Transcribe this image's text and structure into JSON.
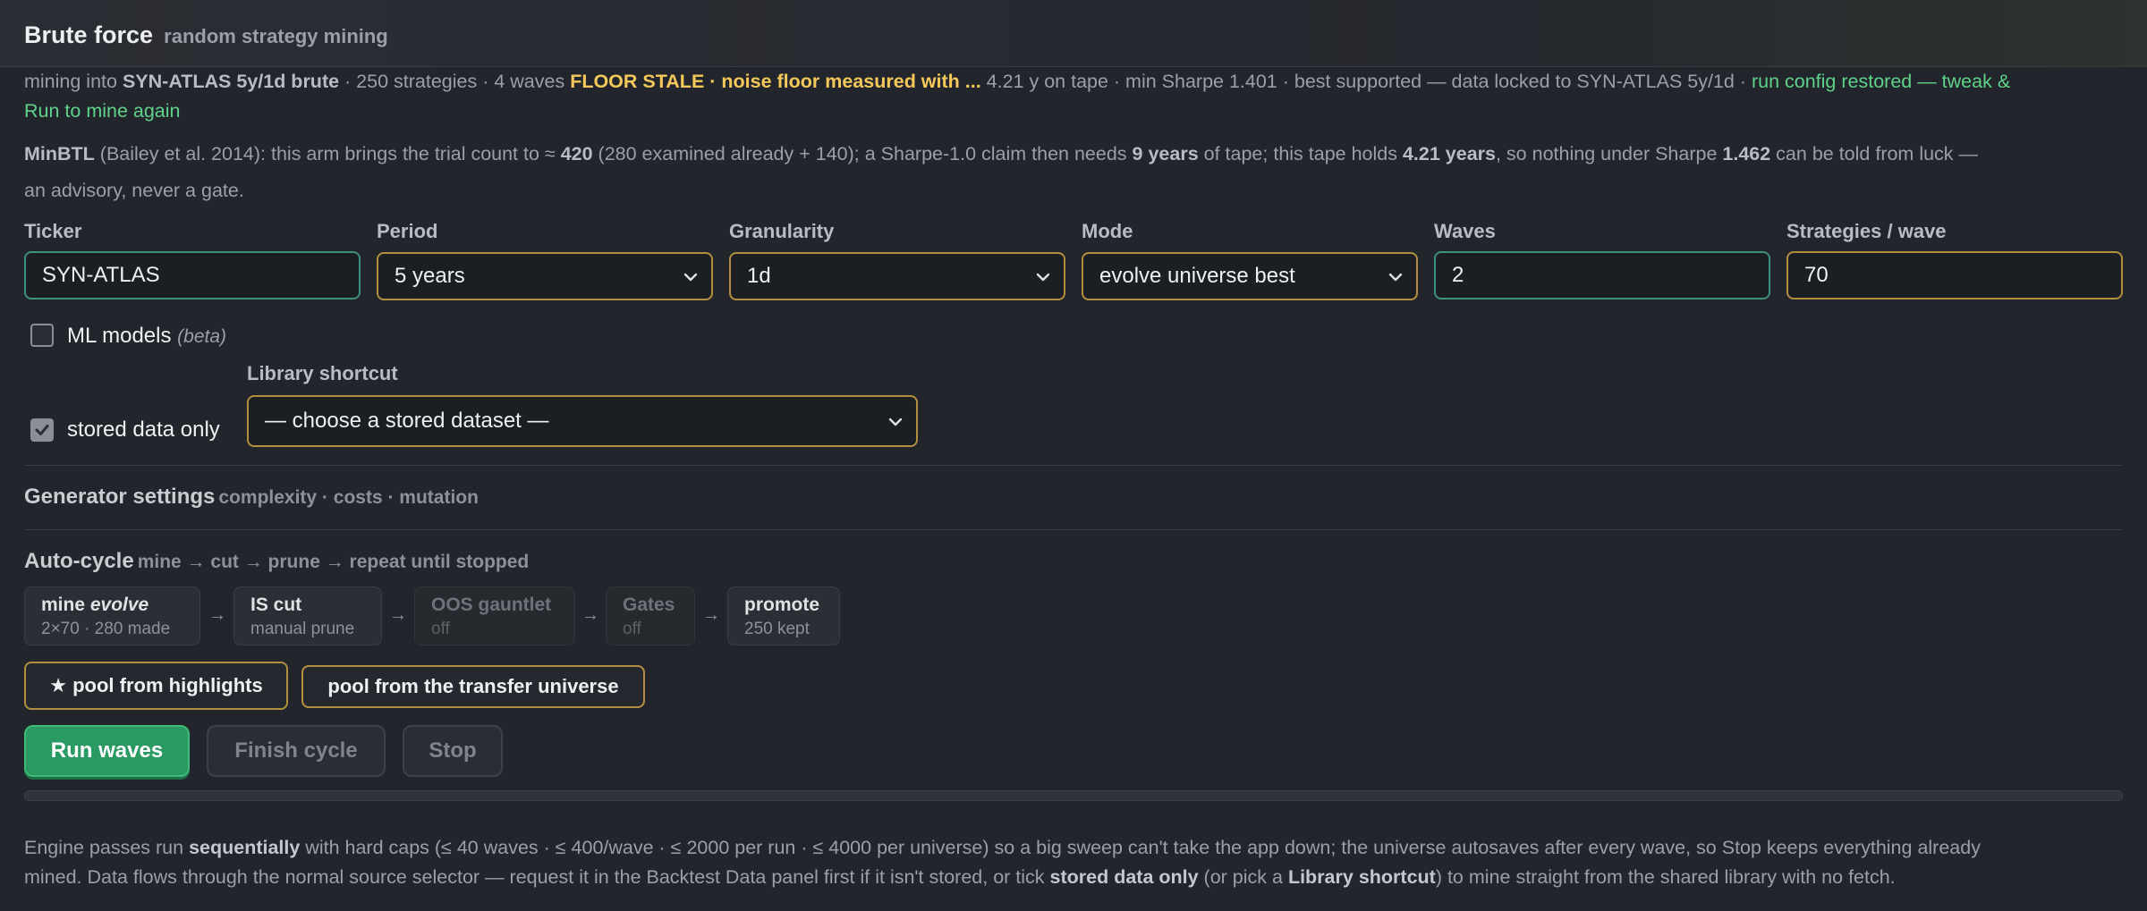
{
  "header": {
    "title": "Brute force",
    "subtitle": "random strategy mining"
  },
  "status": {
    "prefix": "mining into ",
    "target": "SYN-ATLAS 5y/1d brute",
    "mid": " · 250 strategies · 4 waves ",
    "warning": "FLOOR STALE · noise floor measured with ...",
    "tail": " 4.21 y on tape · min Sharpe 1.401 · best supported — data locked to SYN-ATLAS 5y/1d · ",
    "restored1": "run config restored — tweak &",
    "restored2": "Run to mine again"
  },
  "minbtl": {
    "label": "MinBTL",
    "p1": " (Bailey et al. 2014): this arm brings the trial count to ≈ ",
    "count": "420",
    "p2": " (280 examined already + 140); a Sharpe-1.0 claim then needs ",
    "years_needed": "9 years",
    "p3": " of tape; this tape holds ",
    "years_held": "4.21 years",
    "p4": ", so nothing under Sharpe ",
    "sharpe": "1.462",
    "p5": " can be told from luck —",
    "line2": "an advisory, never a gate."
  },
  "form": {
    "ticker": {
      "label": "Ticker",
      "value": "SYN-ATLAS"
    },
    "period": {
      "label": "Period",
      "value": "5 years"
    },
    "granularity": {
      "label": "Granularity",
      "value": "1d"
    },
    "mode": {
      "label": "Mode",
      "value": "evolve universe best"
    },
    "waves": {
      "label": "Waves",
      "value": "2"
    },
    "strategies": {
      "label": "Strategies / wave",
      "value": "70"
    }
  },
  "ml_models": {
    "label": "ML models",
    "tag": "(beta)",
    "checked": false
  },
  "stored_only": {
    "label": "stored data only",
    "checked": true
  },
  "library": {
    "label": "Library shortcut",
    "value": "— choose a stored dataset —"
  },
  "generator": {
    "title": "Generator settings",
    "subtitle": "complexity · costs · mutation"
  },
  "autocycle": {
    "title": "Auto-cycle",
    "subtitle": "mine → cut → prune → repeat until stopped",
    "steps": [
      {
        "title": "mine ",
        "title_em": "evolve",
        "detail": "2×70 · 280 made"
      },
      {
        "title": "IS cut",
        "detail": "manual prune"
      },
      {
        "title": "OOS gauntlet",
        "detail": "off"
      },
      {
        "title": "Gates",
        "detail": "off"
      },
      {
        "title": "promote",
        "detail": "250 kept"
      }
    ],
    "arrow": "→"
  },
  "pools": {
    "highlights": "★ pool from highlights",
    "transfer": "pool from the transfer universe"
  },
  "actions": {
    "run": "Run waves",
    "finish": "Finish cycle",
    "stop": "Stop"
  },
  "progress": {
    "fraction": 0
  },
  "footer": {
    "f1": "Engine passes run ",
    "f1b": "sequentially",
    "f2": " with hard caps (≤ 40 waves · ≤ 400/wave · ≤ 2000 per run · ≤ 4000 per universe) so a big sweep can't take the app down; the universe autosaves after every wave, so Stop keeps everything already",
    "f3": "mined. Data flows through the normal source selector — request it in the Backtest Data panel first if it isn't stored, or tick ",
    "f3b": "stored data only",
    "f4": " (or pick a ",
    "f4b": "Library shortcut",
    "f5": ") to mine straight from the shared library with no fetch."
  },
  "colors": {
    "accent_gold": "#b28f3f",
    "accent_teal": "#3f8f7d",
    "primary": "#2a9a62",
    "warning": "#f5c85a",
    "ok": "#5fd38a"
  }
}
